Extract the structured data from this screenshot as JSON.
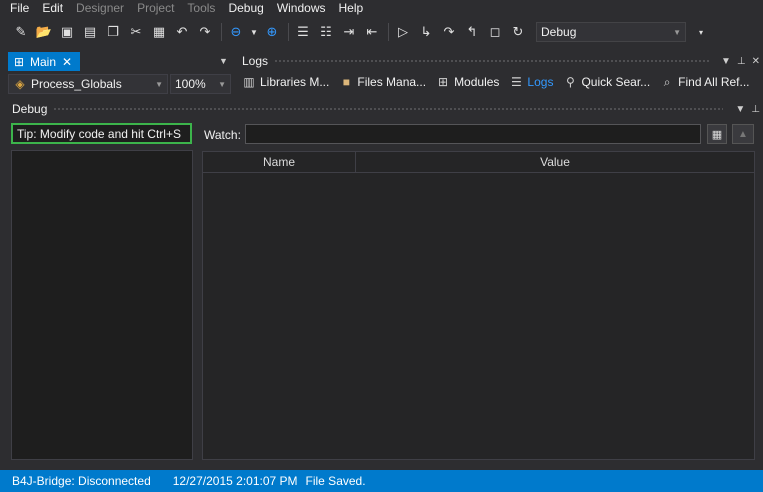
{
  "menu": {
    "file": "File",
    "edit": "Edit",
    "designer": "Designer",
    "project": "Project",
    "tools": "Tools",
    "debug": "Debug",
    "windows": "Windows",
    "help": "Help"
  },
  "toolbar": {
    "config_select": "Debug"
  },
  "editor": {
    "tab_label": "Main",
    "module_select": "Process_Globals",
    "zoom_select": "100%"
  },
  "logs_panel": {
    "title": "Logs",
    "tabs": [
      {
        "label": "Libraries M..."
      },
      {
        "label": "Files Mana..."
      },
      {
        "label": "Modules"
      },
      {
        "label": "Logs"
      },
      {
        "label": "Quick Sear..."
      },
      {
        "label": "Find All Ref..."
      }
    ]
  },
  "debug_panel": {
    "title": "Debug",
    "tip": "Tip: Modify code and hit Ctrl+S",
    "watch_label": "Watch:",
    "watch_value": "",
    "columns": {
      "name": "Name",
      "value": "Value"
    }
  },
  "status": {
    "bridge": "B4J-Bridge: Disconnected",
    "timestamp": "12/27/2015 2:01:07 PM",
    "message": "File Saved."
  },
  "colors": {
    "accent": "#007acc",
    "tip_border": "#3cb44b",
    "background": "#2d2d30"
  }
}
